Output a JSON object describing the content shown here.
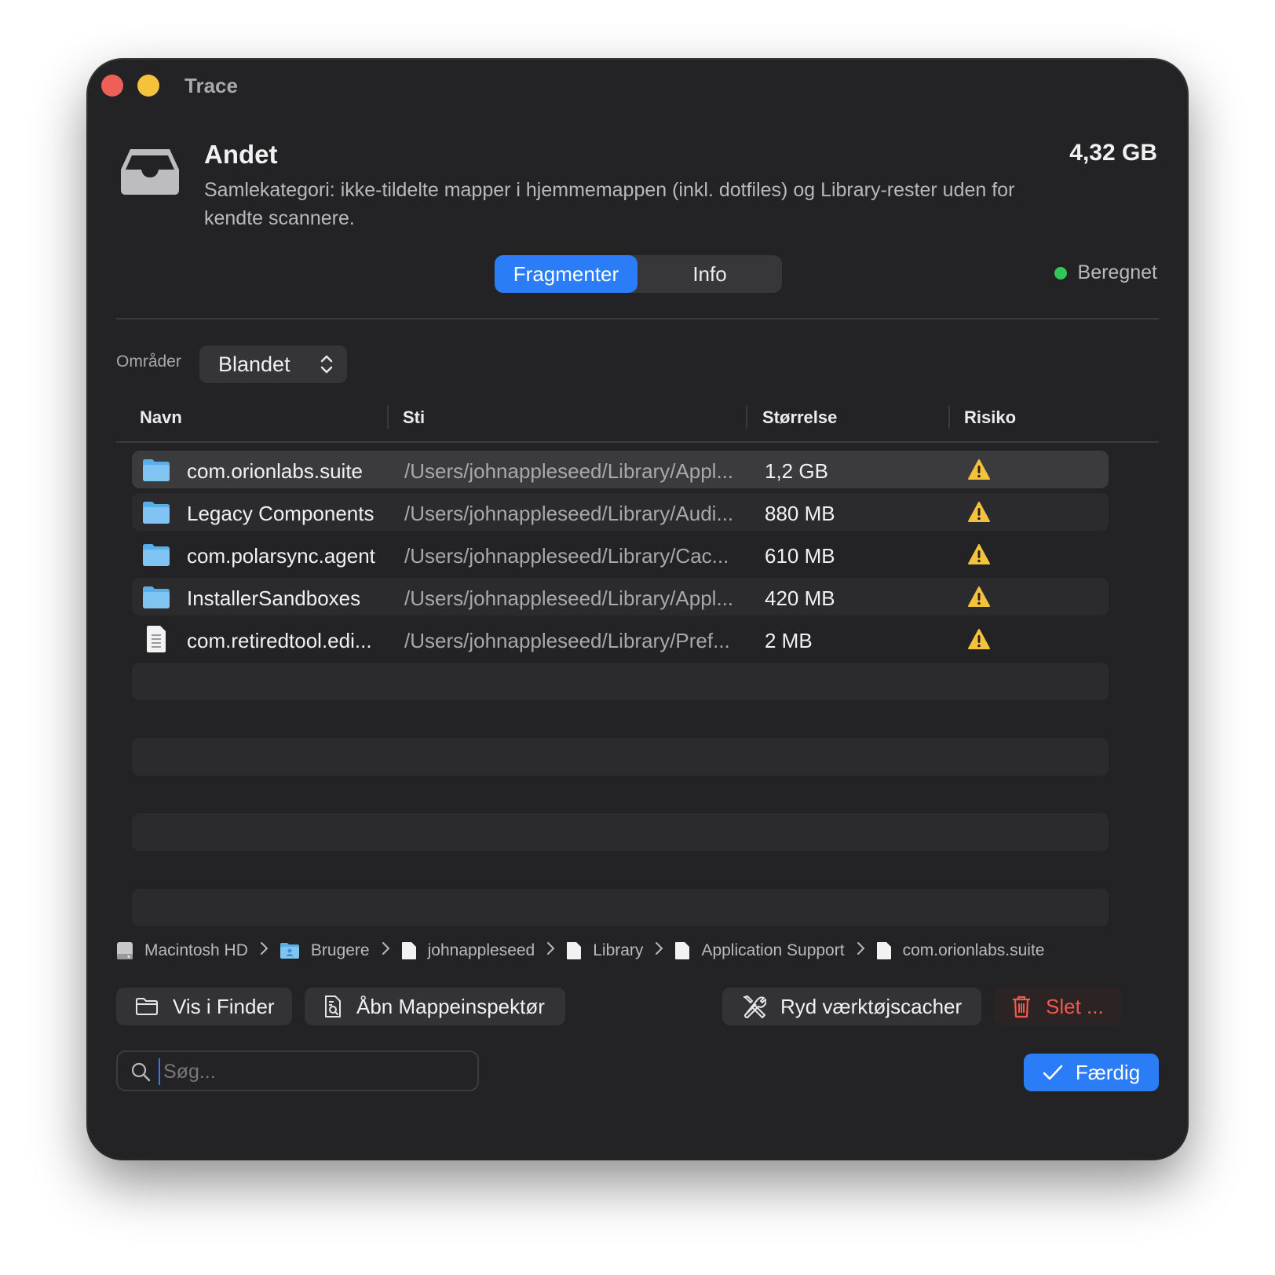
{
  "window": {
    "title": "Trace"
  },
  "category": {
    "title": "Andet",
    "description": "Samlekategori: ikke-tildelte mapper i hjemmemappen (inkl. dotfiles) og Library-rester uden for kendte scannere.",
    "size": "4,32 GB",
    "icon": "tray-icon"
  },
  "tabs": [
    {
      "label": "Fragmenter",
      "active": true
    },
    {
      "label": "Info",
      "active": false
    }
  ],
  "status": {
    "label": "Beregnet",
    "color": "#33c758"
  },
  "filter": {
    "label": "Områder",
    "value": "Blandet"
  },
  "table": {
    "columns": [
      "Navn",
      "Sti",
      "Størrelse",
      "Risiko"
    ],
    "rows": [
      {
        "name": "com.orionlabs.suite",
        "path": "/Users/johnappleseed/Library/Appl...",
        "size": "1,2 GB",
        "icon": "folder-icon",
        "risk": "warning"
      },
      {
        "name": "Legacy Components",
        "path": "/Users/johnappleseed/Library/Audi...",
        "size": "880 MB",
        "icon": "folder-icon",
        "risk": "warning"
      },
      {
        "name": "com.polarsync.agent",
        "path": "/Users/johnappleseed/Library/Cac...",
        "size": "610 MB",
        "icon": "folder-icon",
        "risk": "warning"
      },
      {
        "name": "InstallerSandboxes",
        "path": "/Users/johnappleseed/Library/Appl...",
        "size": "420 MB",
        "icon": "folder-icon",
        "risk": "warning"
      },
      {
        "name": "com.retiredtool.edi...",
        "path": "/Users/johnappleseed/Library/Pref...",
        "size": "2 MB",
        "icon": "document-icon",
        "risk": "warning"
      }
    ]
  },
  "breadcrumb": [
    "Macintosh HD",
    "Brugere",
    "johnappleseed",
    "Library",
    "Application Support",
    "com.orionlabs.suite"
  ],
  "buttons": {
    "show_in_finder": "Vis i Finder",
    "open_inspector": "Åbn Mappeinspektør",
    "clear_caches": "Ryd værktøjscacher",
    "delete": "Slet ...",
    "done": "Færdig"
  },
  "search": {
    "placeholder": "Søg...",
    "value": ""
  },
  "colors": {
    "accent": "#2a7df6",
    "danger": "#ee5a4f",
    "warning": "#f5c33b",
    "background": "#232325"
  }
}
